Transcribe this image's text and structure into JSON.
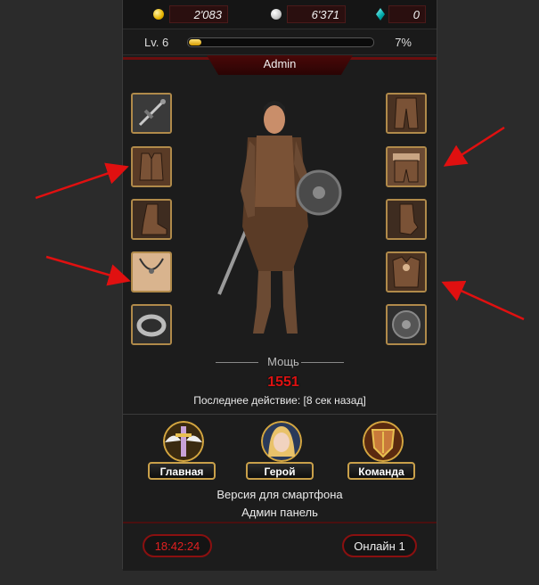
{
  "currency": {
    "gold": "2'083",
    "silver": "6'371",
    "gems": "0"
  },
  "level": {
    "label": "Lv. 6",
    "progress_fraction": 0.07,
    "percent_text": "7%"
  },
  "character": {
    "name": "Admin",
    "power_label": "Мощь",
    "power_value": "1551",
    "last_action": "Последнее действие: [8 сек назад]"
  },
  "equipment": {
    "left": [
      "sword-slot",
      "vest-slot",
      "boots-slot",
      "necklace-slot",
      "ring-slot"
    ],
    "right": [
      "pants-slot",
      "belt-pants-slot",
      "gloves-slot",
      "armor-slot",
      "shield-slot"
    ]
  },
  "nav": {
    "main": "Главная",
    "hero": "Герой",
    "team": "Команда"
  },
  "footer": {
    "mobile_version": "Версия для смартфона",
    "admin_panel": "Админ панель",
    "clock": "18:42:24",
    "online": "Онлайн 1"
  },
  "colors": {
    "accent_red": "#d11111",
    "annotation_arrow": "#e01010",
    "slot_border": "#b08a4a"
  }
}
